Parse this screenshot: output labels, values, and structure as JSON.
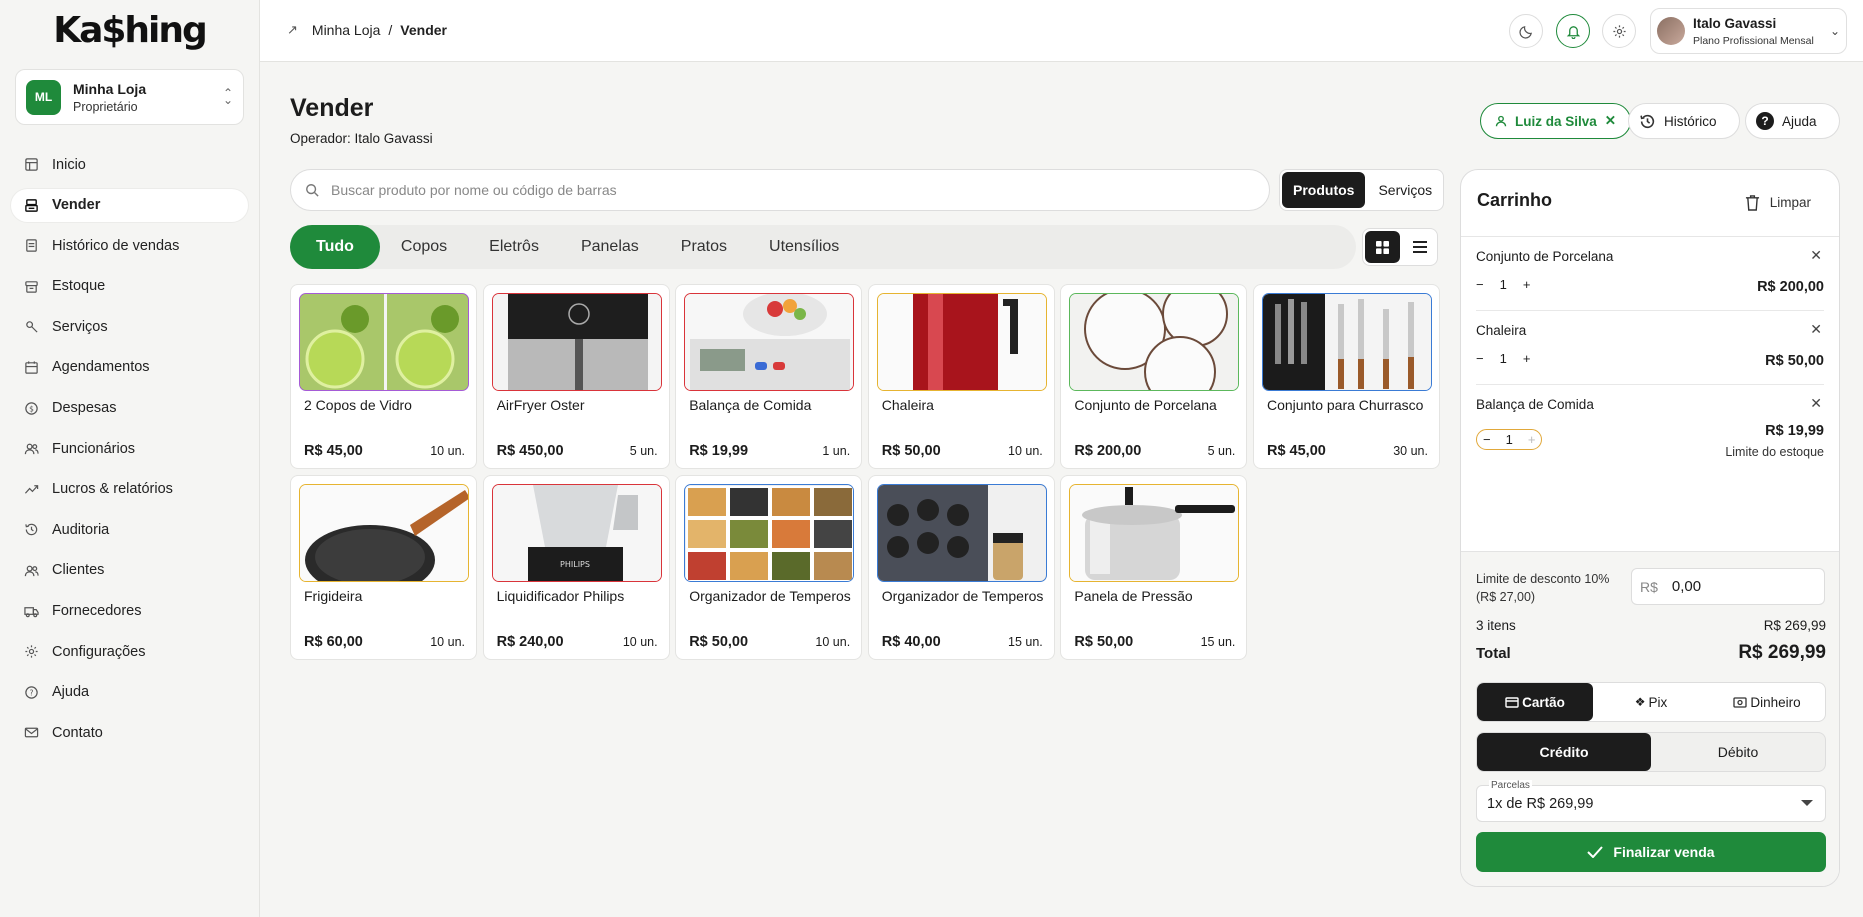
{
  "app": {
    "logo": "Ka$hing"
  },
  "store": {
    "initials": "ML",
    "name": "Minha Loja",
    "role": "Proprietário"
  },
  "sidebar": {
    "items": [
      {
        "label": "Inicio",
        "icon": "home-icon"
      },
      {
        "label": "Vender",
        "icon": "register-icon",
        "active": true
      },
      {
        "label": "Histórico de vendas",
        "icon": "receipt-icon"
      },
      {
        "label": "Estoque",
        "icon": "box-icon"
      },
      {
        "label": "Serviços",
        "icon": "tools-icon"
      },
      {
        "label": "Agendamentos",
        "icon": "calendar-icon"
      },
      {
        "label": "Despesas",
        "icon": "dollar-icon"
      },
      {
        "label": "Funcionários",
        "icon": "users-icon"
      },
      {
        "label": "Lucros & relatórios",
        "icon": "chart-icon"
      },
      {
        "label": "Auditoria",
        "icon": "history-icon"
      },
      {
        "label": "Clientes",
        "icon": "clients-icon"
      },
      {
        "label": "Fornecedores",
        "icon": "truck-icon"
      },
      {
        "label": "Configurações",
        "icon": "gear-icon"
      },
      {
        "label": "Ajuda",
        "icon": "help-icon"
      },
      {
        "label": "Contato",
        "icon": "mail-icon"
      }
    ]
  },
  "header": {
    "breadcrumb": {
      "parent": "Minha Loja",
      "separator": "/",
      "current": "Vender"
    },
    "user": {
      "name": "Italo Gavassi",
      "plan": "Plano Profissional Mensal"
    }
  },
  "main": {
    "title": "Vender",
    "operator": "Operador: Italo Gavassi",
    "client_label": "Luiz da Silva",
    "history_label": "Histórico",
    "help_label": "Ajuda",
    "search_placeholder": "Buscar produto por nome ou código de barras",
    "mode_tabs": [
      "Produtos",
      "Serviços"
    ],
    "categories": [
      "Tudo",
      "Copos",
      "Eletrôs",
      "Panelas",
      "Pratos",
      "Utensílios"
    ],
    "products": [
      {
        "name": "2 Copos de Vidro",
        "price": "R$ 45,00",
        "stock": "10 un.",
        "border": "#a55bd6",
        "img": "limes"
      },
      {
        "name": "AirFryer Oster",
        "price": "R$ 450,00",
        "stock": "5 un.",
        "border": "#d9343a",
        "img": "airfryer"
      },
      {
        "name": "Balança de Comida",
        "price": "R$ 19,99",
        "stock": "1 un.",
        "border": "#d9343a",
        "img": "scale"
      },
      {
        "name": "Chaleira",
        "price": "R$ 50,00",
        "stock": "10 un.",
        "border": "#e6b431",
        "img": "kettle"
      },
      {
        "name": "Conjunto de Porcelana",
        "price": "R$ 200,00",
        "stock": "5 un.",
        "border": "#5cb85c",
        "img": "plates"
      },
      {
        "name": "Conjunto para Churrasco",
        "price": "R$ 45,00",
        "stock": "30 un.",
        "border": "#3a7bd5",
        "img": "knives"
      },
      {
        "name": "Frigideira",
        "price": "R$ 60,00",
        "stock": "10 un.",
        "border": "#e6b431",
        "img": "pan"
      },
      {
        "name": "Liquidificador Philips",
        "price": "R$ 240,00",
        "stock": "10 un.",
        "border": "#d9343a",
        "img": "blender"
      },
      {
        "name": "Organizador de Temperos",
        "price": "R$ 50,00",
        "stock": "10 un.",
        "border": "#3a7bd5",
        "img": "jars"
      },
      {
        "name": "Organizador de Temperos",
        "price": "R$ 40,00",
        "stock": "15 un.",
        "border": "#3a7bd5",
        "img": "rack"
      },
      {
        "name": "Panela de Pressão",
        "price": "R$ 50,00",
        "stock": "15 un.",
        "border": "#e6b431",
        "img": "pressure"
      }
    ]
  },
  "cart": {
    "title": "Carrinho",
    "clear_label": "Limpar",
    "items": [
      {
        "name": "Conjunto de Porcelana",
        "qty": "1",
        "price": "R$ 200,00"
      },
      {
        "name": "Chaleira",
        "qty": "1",
        "price": "R$ 50,00"
      },
      {
        "name": "Balança de Comida",
        "qty": "1",
        "price": "R$ 19,99",
        "note": "Limite do estoque"
      }
    ],
    "discount_label": "Limite de desconto 10% (R$ 27,00)",
    "discount_currency": "R$",
    "discount_value": "0,00",
    "items_count": "3 itens",
    "subtotal": "R$ 269,99",
    "total_label": "Total",
    "total": "R$ 269,99",
    "payment_methods": [
      "Cartão",
      "Pix",
      "Dinheiro"
    ],
    "card_types": [
      "Crédito",
      "Débito"
    ],
    "installments_label": "Parcelas",
    "installments_value": "1x de R$ 269,99",
    "finish_label": "Finalizar venda"
  },
  "colors": {
    "accent": "#1f8a3b",
    "dark": "#1c1c1c",
    "warning": "#e1a83a"
  }
}
